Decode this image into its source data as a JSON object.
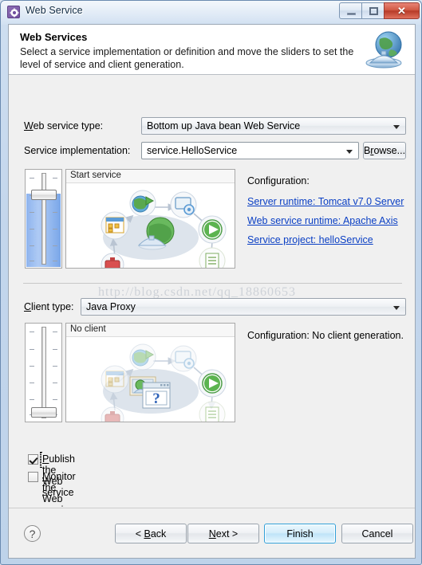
{
  "window": {
    "title": "Web Service",
    "icon": "gear-icon",
    "controls": {
      "minimize": "minimize-icon",
      "maximize": "maximize-icon",
      "close": "✕"
    }
  },
  "banner": {
    "title": "Web Services",
    "description": "Select a service implementation or definition and move the sliders to set the level of service and client generation.",
    "icon": "globe-service-icon"
  },
  "form": {
    "web_service_type": {
      "label_pre": "W",
      "label_post": "eb service type:",
      "value": "Bottom up Java bean Web Service"
    },
    "service_implementation": {
      "label": "Service implementation:",
      "value": "service.HelloService",
      "browse_pre": "B",
      "browse_mid": "r",
      "browse_post": "owse..."
    },
    "client_type": {
      "label_pre": "C",
      "label_post": "lient type:",
      "value": "Java Proxy"
    }
  },
  "service_panel": {
    "diagram_title": "Start service",
    "slider_level": "start-service",
    "configuration_label": "Configuration:",
    "links": [
      "Server runtime: Tomcat v7.0 Server",
      "Web service runtime: Apache Axis",
      "Service project: helloService"
    ]
  },
  "client_panel": {
    "diagram_title": "No client",
    "slider_level": "no-client",
    "configuration_text": "Configuration: No client generation."
  },
  "options": [
    {
      "label_pre": "P",
      "label_post": "ublish the Web service",
      "checked": true,
      "focused": true
    },
    {
      "label_pre": "M",
      "label_post": "onitor the Web service",
      "checked": false,
      "focused": false
    }
  ],
  "footer": {
    "help": "?",
    "back_pre": "< ",
    "back_mid": "B",
    "back_post": "ack",
    "next_pre": "",
    "next_mid": "N",
    "next_post": "ext >",
    "finish": "Finish",
    "cancel": "Cancel"
  },
  "watermark": "http://blog.csdn.net/qq_18860653",
  "colors": {
    "link": "#0a3fc4",
    "slider_fill": "#9dbff1",
    "default_button_border": "#2f9fd8",
    "title_icon": "#7150a0"
  }
}
